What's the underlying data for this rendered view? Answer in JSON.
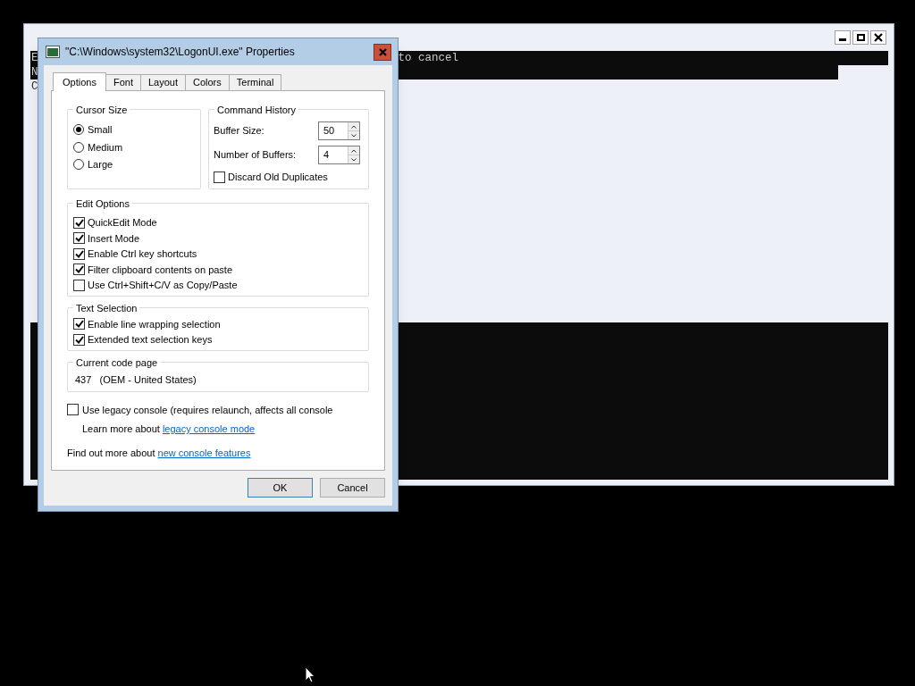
{
  "console_window": {
    "lines": [
      {
        "left": "E",
        "right": "to cancel"
      },
      {
        "left": "N"
      },
      {
        "left": "C"
      }
    ]
  },
  "dialog": {
    "title": "\"C:\\Windows\\system32\\LogonUI.exe\" Properties",
    "tabs": [
      {
        "label": "Options",
        "selected": true
      },
      {
        "label": "Font",
        "selected": false
      },
      {
        "label": "Layout",
        "selected": false
      },
      {
        "label": "Colors",
        "selected": false
      },
      {
        "label": "Terminal",
        "selected": false
      }
    ],
    "cursor_size": {
      "label": "Cursor Size",
      "options": [
        {
          "label": "Small",
          "selected": true
        },
        {
          "label": "Medium",
          "selected": false
        },
        {
          "label": "Large",
          "selected": false
        }
      ]
    },
    "command_history": {
      "label": "Command History",
      "fields": [
        {
          "label": "Buffer Size:",
          "value": "50"
        },
        {
          "label": "Number of Buffers:",
          "value": "4"
        }
      ],
      "discard": {
        "label": "Discard Old Duplicates",
        "checked": false
      }
    },
    "edit_options": {
      "label": "Edit Options",
      "items": [
        {
          "label": "QuickEdit Mode",
          "checked": true
        },
        {
          "label": "Insert Mode",
          "checked": true
        },
        {
          "label": "Enable Ctrl key shortcuts",
          "checked": true
        },
        {
          "label": "Filter clipboard contents on paste",
          "checked": true
        },
        {
          "label": "Use Ctrl+Shift+C/V as Copy/Paste",
          "checked": false
        }
      ]
    },
    "text_selection": {
      "label": "Text Selection",
      "items": [
        {
          "label": "Enable line wrapping selection",
          "checked": true
        },
        {
          "label": "Extended text selection keys",
          "checked": true
        }
      ]
    },
    "code_page": {
      "label": "Current code page",
      "value": "437   (OEM - United States)"
    },
    "legacy": {
      "label": "Use legacy console (requires relaunch, affects all console",
      "checked": false
    },
    "learn_more": {
      "text": "Learn more about",
      "link": "legacy console mode"
    },
    "find_out": {
      "text": "Find out more about",
      "link": "new console features"
    },
    "buttons": [
      {
        "label": "OK"
      },
      {
        "label": "Cancel"
      }
    ]
  }
}
